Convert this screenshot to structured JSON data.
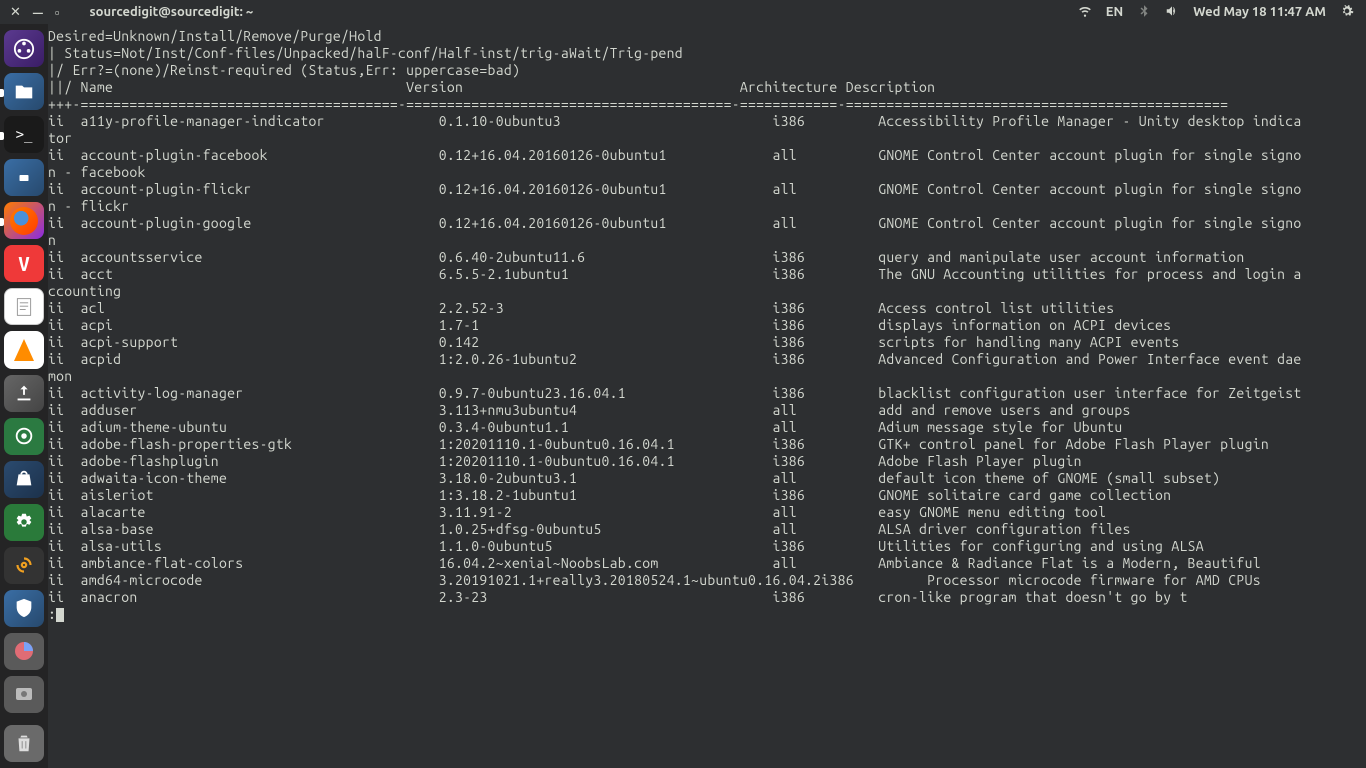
{
  "panel": {
    "title": "sourcedigit@sourcedigit: ~",
    "lang": "EN",
    "clock": "Wed May 18 11:47 AM"
  },
  "terminal": {
    "header": [
      "Desired=Unknown/Install/Remove/Purge/Hold",
      "| Status=Not/Inst/Conf-files/Unpacked/halF-conf/Half-inst/trig-aWait/Trig-pend",
      "|/ Err?=(none)/Reinst-required (Status,Err: uppercase=bad)",
      "||/ Name                                    Version                                  Architecture Description",
      "+++-=======================================-========================================-============-==============================================="
    ],
    "rows": [
      {
        "s": "ii ",
        "n": "a11y-profile-manager-indicator",
        "v": "0.1.10-0ubuntu3",
        "a": "i386",
        "d": "Accessibility Profile Manager - Unity desktop indicator"
      },
      {
        "s": "ii ",
        "n": "account-plugin-facebook",
        "v": "0.12+16.04.20160126-0ubuntu1",
        "a": "all",
        "d": "GNOME Control Center account plugin for single signon - facebook"
      },
      {
        "s": "ii ",
        "n": "account-plugin-flickr",
        "v": "0.12+16.04.20160126-0ubuntu1",
        "a": "all",
        "d": "GNOME Control Center account plugin for single signon - flickr"
      },
      {
        "s": "ii ",
        "n": "account-plugin-google",
        "v": "0.12+16.04.20160126-0ubuntu1",
        "a": "all",
        "d": "GNOME Control Center account plugin for single signon"
      },
      {
        "s": "ii ",
        "n": "accountsservice",
        "v": "0.6.40-2ubuntu11.6",
        "a": "i386",
        "d": "query and manipulate user account information"
      },
      {
        "s": "ii ",
        "n": "acct",
        "v": "6.5.5-2.1ubuntu1",
        "a": "i386",
        "d": "The GNU Accounting utilities for process and login accounting"
      },
      {
        "s": "ii ",
        "n": "acl",
        "v": "2.2.52-3",
        "a": "i386",
        "d": "Access control list utilities"
      },
      {
        "s": "ii ",
        "n": "acpi",
        "v": "1.7-1",
        "a": "i386",
        "d": "displays information on ACPI devices"
      },
      {
        "s": "ii ",
        "n": "acpi-support",
        "v": "0.142",
        "a": "i386",
        "d": "scripts for handling many ACPI events"
      },
      {
        "s": "ii ",
        "n": "acpid",
        "v": "1:2.0.26-1ubuntu2",
        "a": "i386",
        "d": "Advanced Configuration and Power Interface event daemon"
      },
      {
        "s": "ii ",
        "n": "activity-log-manager",
        "v": "0.9.7-0ubuntu23.16.04.1",
        "a": "i386",
        "d": "blacklist configuration user interface for Zeitgeist"
      },
      {
        "s": "ii ",
        "n": "adduser",
        "v": "3.113+nmu3ubuntu4",
        "a": "all",
        "d": "add and remove users and groups"
      },
      {
        "s": "ii ",
        "n": "adium-theme-ubuntu",
        "v": "0.3.4-0ubuntu1.1",
        "a": "all",
        "d": "Adium message style for Ubuntu"
      },
      {
        "s": "ii ",
        "n": "adobe-flash-properties-gtk",
        "v": "1:20201110.1-0ubuntu0.16.04.1",
        "a": "i386",
        "d": "GTK+ control panel for Adobe Flash Player plugin"
      },
      {
        "s": "ii ",
        "n": "adobe-flashplugin",
        "v": "1:20201110.1-0ubuntu0.16.04.1",
        "a": "i386",
        "d": "Adobe Flash Player plugin"
      },
      {
        "s": "ii ",
        "n": "adwaita-icon-theme",
        "v": "3.18.0-2ubuntu3.1",
        "a": "all",
        "d": "default icon theme of GNOME (small subset)"
      },
      {
        "s": "ii ",
        "n": "aisleriot",
        "v": "1:3.18.2-1ubuntu1",
        "a": "i386",
        "d": "GNOME solitaire card game collection"
      },
      {
        "s": "ii ",
        "n": "alacarte",
        "v": "3.11.91-2",
        "a": "all",
        "d": "easy GNOME menu editing tool"
      },
      {
        "s": "ii ",
        "n": "alsa-base",
        "v": "1.0.25+dfsg-0ubuntu5",
        "a": "all",
        "d": "ALSA driver configuration files"
      },
      {
        "s": "ii ",
        "n": "alsa-utils",
        "v": "1.1.0-0ubuntu5",
        "a": "i386",
        "d": "Utilities for configuring and using ALSA"
      },
      {
        "s": "ii ",
        "n": "ambiance-flat-colors",
        "v": "16.04.2~xenial~NoobsLab.com",
        "a": "all",
        "d": "Ambiance & Radiance Flat is a Modern, Beautiful"
      },
      {
        "s": "ii ",
        "n": "amd64-microcode",
        "v": "3.20191021.1+really3.20180524.1~ubuntu0.16.04.2",
        "a": "i386",
        "d": "Processor microcode firmware for AMD CPUs"
      },
      {
        "s": "ii ",
        "n": "anacron",
        "v": "2.3-23",
        "a": "i386",
        "d": "cron-like program that doesn't go by t"
      }
    ],
    "prompt": ":"
  },
  "cols": {
    "name_start": 4,
    "version_start": 48,
    "arch_start": 89,
    "desc_start": 102,
    "width": 154
  }
}
